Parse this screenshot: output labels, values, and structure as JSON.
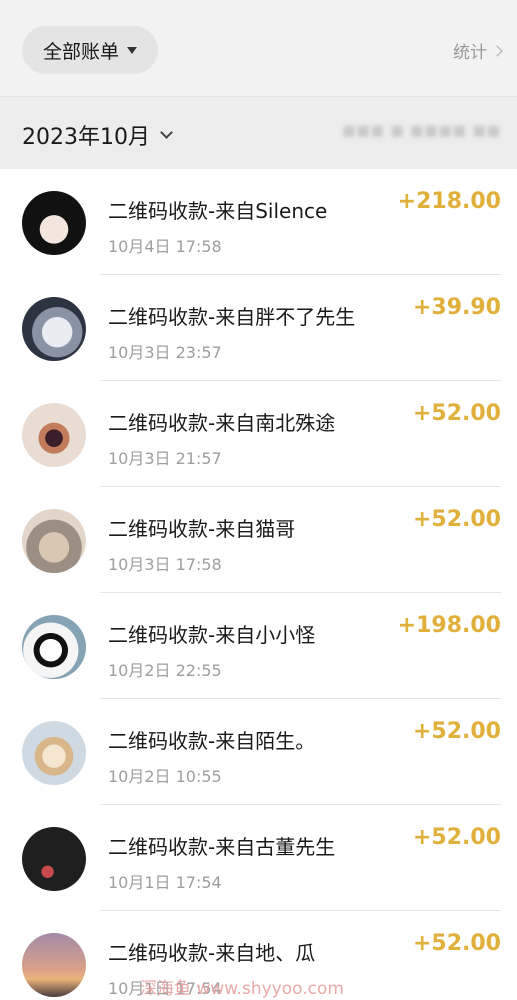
{
  "header": {
    "filter_label": "全部账单",
    "stats_label": "统计"
  },
  "month": {
    "label": "2023年10月",
    "summary": "■■■ ■ ■■■■ ■■"
  },
  "transactions": [
    {
      "title": "二维码收款-来自Silence",
      "time": "10月4日 17:58",
      "amount": "+218.00"
    },
    {
      "title": "二维码收款-来自胖不了先生",
      "time": "10月3日 23:57",
      "amount": "+39.90"
    },
    {
      "title": "二维码收款-来自南北殊途",
      "time": "10月3日 21:57",
      "amount": "+52.00"
    },
    {
      "title": "二维码收款-来自猫哥",
      "time": "10月3日 17:58",
      "amount": "+52.00"
    },
    {
      "title": "二维码收款-来自小小怪",
      "time": "10月2日 22:55",
      "amount": "+198.00"
    },
    {
      "title": "二维码收款-来自陌生。",
      "time": "10月2日 10:55",
      "amount": "+52.00"
    },
    {
      "title": "二维码收款-来自古董先生",
      "time": "10月1日 17:54",
      "amount": "+52.00"
    },
    {
      "title": "二维码收款-来自地、瓜",
      "time": "10月1日 17:54",
      "amount": "+52.00"
    }
  ],
  "watermark": "深海鱼 www.shyyoo.com",
  "colors": {
    "amount": "#e0b03a",
    "header_bg": "#f2f2f2",
    "month_bg": "#ededed"
  }
}
